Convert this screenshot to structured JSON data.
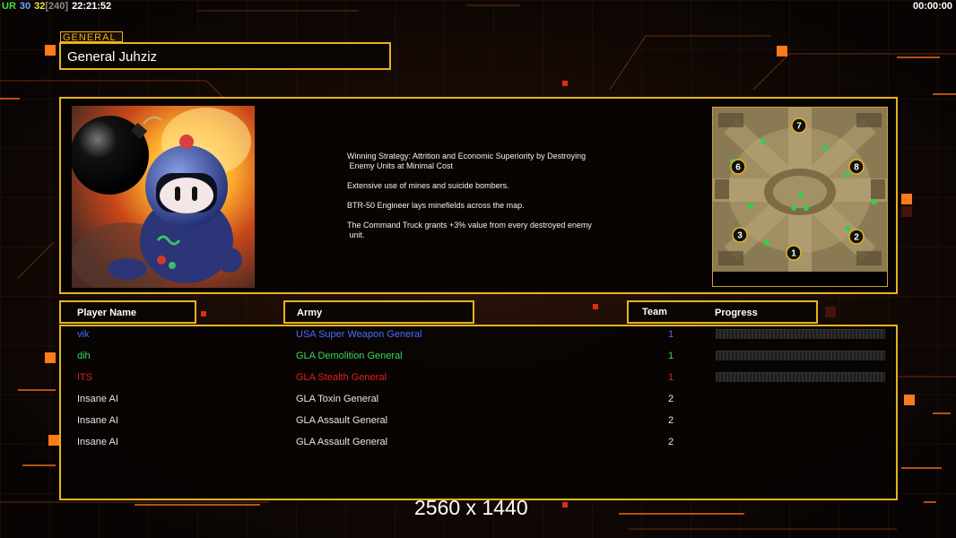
{
  "hud": {
    "left_parts": [
      {
        "text": "UR",
        "color": "#3fe03f"
      },
      {
        "text": "30",
        "color": "#6fa7ff"
      },
      {
        "text": "32",
        "color": "#f2e34a"
      },
      {
        "text": "[240]",
        "color": "#8c8c8c"
      },
      {
        "text": "22:21:52",
        "color": "#ffffff"
      }
    ],
    "right_clock": "00:00:00"
  },
  "general": {
    "tag": "GENERAL",
    "name": "General Juhziz",
    "strategy": [
      "Winning Strategy: Attrition and Economic Superiority by Destroying\n Enemy Units at Minimal Cost",
      "Extensive use of mines and suicide bombers.",
      "BTR-50 Engineer lays minefields across the map.",
      "The Command Truck grants +3% value from every destroyed enemy\n unit."
    ],
    "portrait_icon": "bomberman-portrait-icon"
  },
  "minimap": {
    "icon": "map-preview-icon",
    "start_positions": [
      "7",
      "6",
      "8",
      "3",
      "2",
      "1"
    ]
  },
  "table": {
    "headers": {
      "player": "Player Name",
      "army": "Army",
      "team": "Team",
      "progress": "Progress"
    },
    "rows": [
      {
        "player": "vik",
        "army": "USA Super Weapon General",
        "team": "1",
        "color": "#4a6cff",
        "has_progress": true
      },
      {
        "player": "dih",
        "army": "GLA Demolition General",
        "team": "1",
        "color": "#39d85a",
        "has_progress": true
      },
      {
        "player": "ITS",
        "army": "GLA Stealth General",
        "team": "1",
        "color": "#e02020",
        "has_progress": true
      },
      {
        "player": "Insane AI",
        "army": "GLA Toxin General",
        "team": "2",
        "color": "#e6e6e6",
        "has_progress": false
      },
      {
        "player": "Insane AI",
        "army": "GLA Assault General",
        "team": "2",
        "color": "#e6e6e6",
        "has_progress": false
      },
      {
        "player": "Insane AI",
        "army": "GLA Assault General",
        "team": "2",
        "color": "#e6e6e6",
        "has_progress": false
      }
    ]
  },
  "overlay": {
    "resolution": "2560 x 1440"
  },
  "colors": {
    "frame": "#e6b321",
    "accent_orange": "#ff7a1a"
  }
}
